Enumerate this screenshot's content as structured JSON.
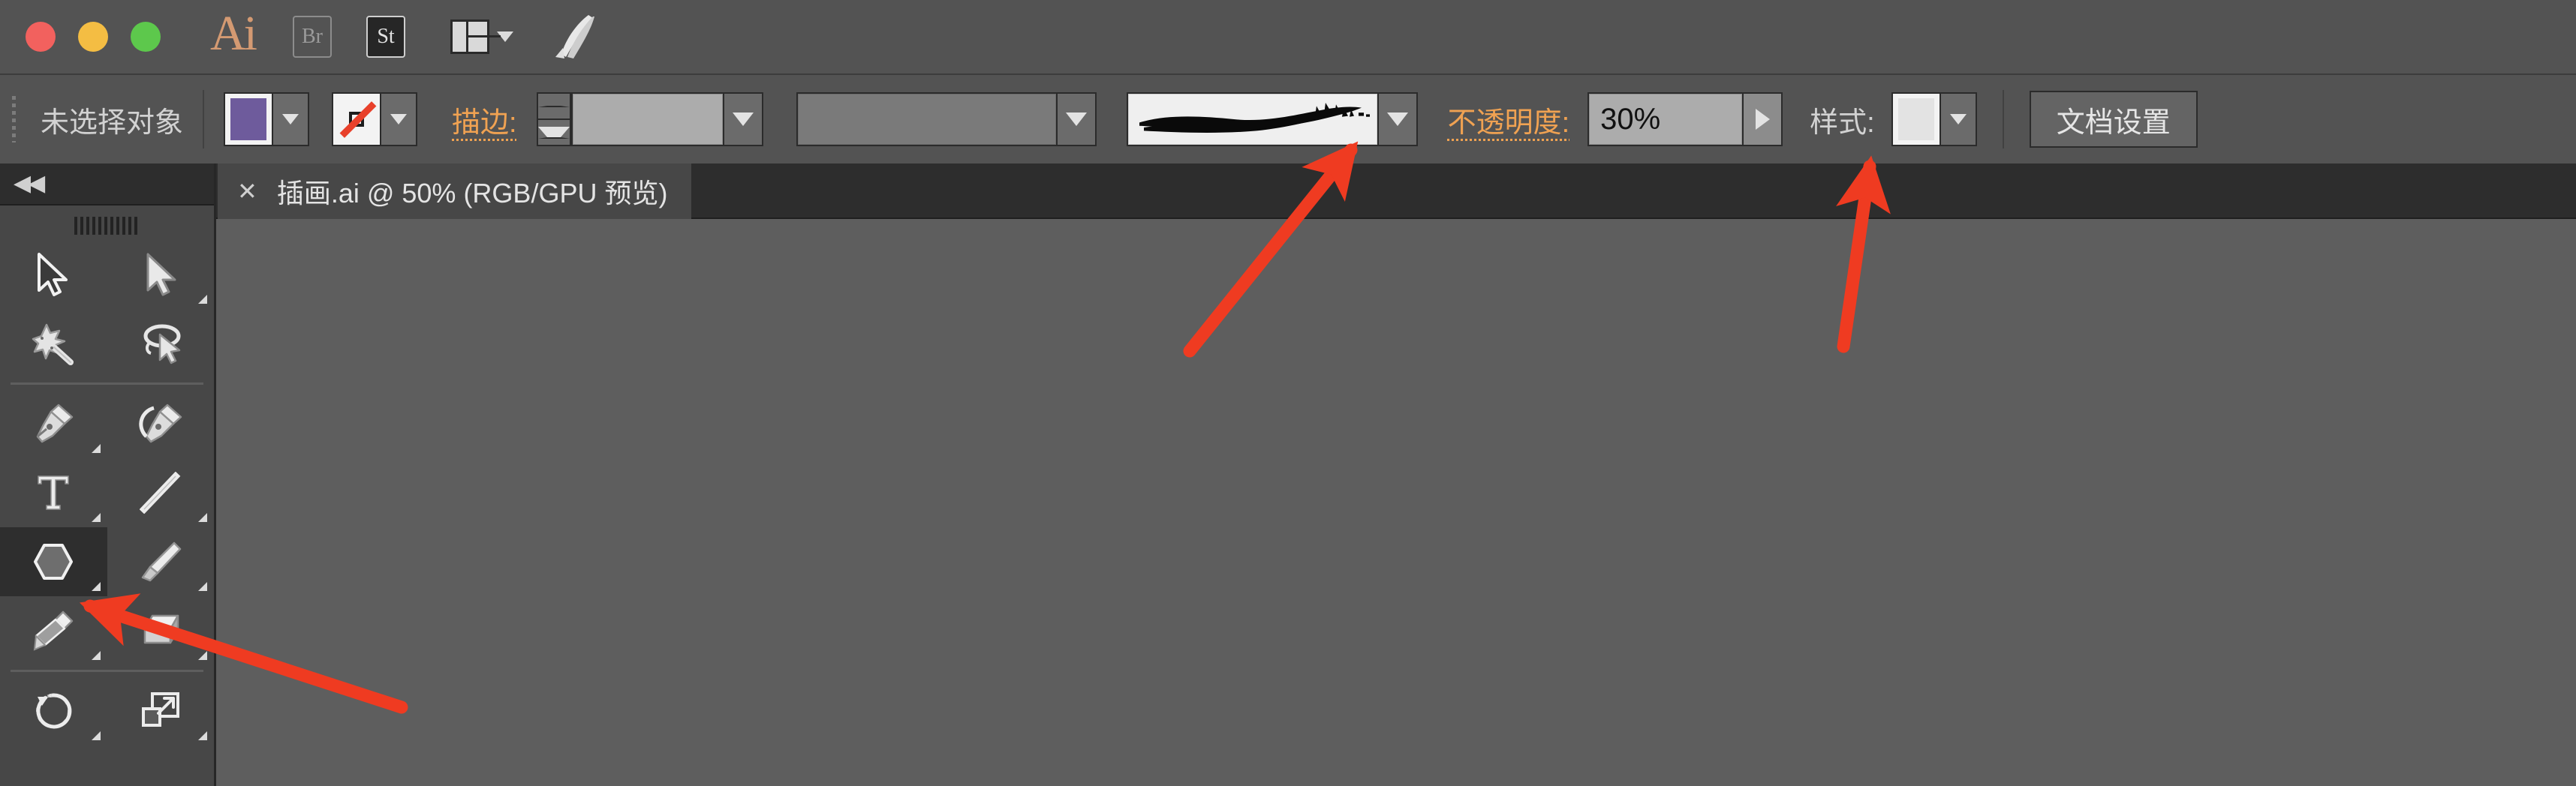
{
  "app": {
    "name_icon": "ai-logo",
    "logo_text": "Ai",
    "bridge_label": "Br",
    "stock_label": "St"
  },
  "titlebar": {
    "traffic_lights": [
      {
        "name": "close",
        "color": "#f2615e"
      },
      {
        "name": "minimize",
        "color": "#f4bd43"
      },
      {
        "name": "zoom",
        "color": "#5dc84c"
      }
    ]
  },
  "controlbar": {
    "selection_status": "未选择对象",
    "fill_color": "#6e5b9c",
    "stroke_color": "none",
    "stroke_label": "描边:",
    "stroke_weight_value": "",
    "stroke_profile_value": "",
    "brush_definition_value": "炭笔 - 羽毛",
    "opacity_label": "不透明度:",
    "opacity_value": "30%",
    "style_label": "样式:",
    "style_swatch": "#e3e3e3",
    "document_setup_label": "文档设置",
    "accent_orange": "#f0a252"
  },
  "tabbar": {
    "close_glyph": "✕",
    "document_title": "插画.ai @ 50% (RGB/GPU 预览)"
  },
  "toolpanel": {
    "collapse_glyph": "◀◀",
    "tools": [
      {
        "name": "selection-tool",
        "label": "选择工具",
        "has_flyout": false,
        "active": false
      },
      {
        "name": "direct-selection-tool",
        "label": "直接选择工具",
        "has_flyout": true,
        "active": false
      },
      {
        "name": "magic-wand-tool",
        "label": "魔棒工具",
        "has_flyout": false,
        "active": false
      },
      {
        "name": "lasso-tool",
        "label": "套索工具",
        "has_flyout": false,
        "active": false
      },
      {
        "name": "pen-tool",
        "label": "钢笔工具",
        "has_flyout": true,
        "active": false
      },
      {
        "name": "curvature-tool",
        "label": "曲率工具",
        "has_flyout": false,
        "active": false
      },
      {
        "name": "type-tool",
        "label": "文字工具",
        "has_flyout": true,
        "active": false
      },
      {
        "name": "line-segment-tool",
        "label": "直线段工具",
        "has_flyout": true,
        "active": false
      },
      {
        "name": "polygon-shape-tool",
        "label": "多边形工具",
        "has_flyout": true,
        "active": true
      },
      {
        "name": "paintbrush-tool",
        "label": "画笔工具",
        "has_flyout": true,
        "active": false
      },
      {
        "name": "pencil-tool",
        "label": "铅笔工具",
        "has_flyout": true,
        "active": false
      },
      {
        "name": "eraser-tool",
        "label": "橡皮擦工具",
        "has_flyout": true,
        "active": false
      },
      {
        "name": "rotate-tool",
        "label": "旋转工具",
        "has_flyout": true,
        "active": false
      },
      {
        "name": "scale-tool",
        "label": "比例缩放工具",
        "has_flyout": true,
        "active": false
      }
    ]
  },
  "annotations": {
    "arrow_color": "#ef3b21",
    "arrows": [
      {
        "name": "arrow-to-brush-definition",
        "target": "brush-definition-combo"
      },
      {
        "name": "arrow-to-opacity-field",
        "target": "opacity-input"
      },
      {
        "name": "arrow-to-polygon-tool",
        "target": "polygon-shape-tool"
      }
    ]
  },
  "colors": {
    "chrome": "#535353",
    "panel": "#474747",
    "tabbar": "#2d2d2d",
    "canvas": "#5e5e5e"
  }
}
